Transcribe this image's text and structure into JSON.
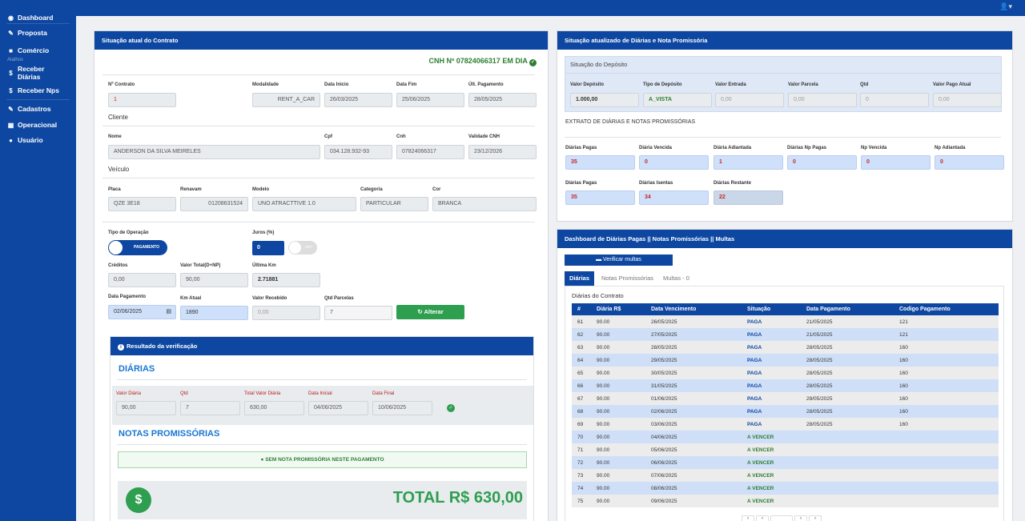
{
  "sidebar": {
    "items": [
      "Dashboard",
      "Proposta",
      "Comércio"
    ],
    "shortcut_label": "Atalhos",
    "shortcuts": [
      "Receber Diárias",
      "Receber Nps"
    ],
    "items2": [
      "Cadastros",
      "Operacional",
      "Usuário"
    ]
  },
  "left": {
    "title": "Situação atual do Contrato",
    "cnh_status": "CNH Nº 07824066317 EM DIA",
    "contract": {
      "labels": [
        "Nº Contrato",
        "Modalidade",
        "Data Inicio",
        "Data Fim",
        "Últ. Pagamento"
      ],
      "values": [
        "1",
        "RENT_A_CAR",
        "26/03/2025",
        "25/06/2025",
        "28/05/2025"
      ]
    },
    "client": {
      "section": "Cliente",
      "labels": [
        "Nome",
        "Cpf",
        "Cnh",
        "Validade CNH"
      ],
      "values": [
        "ANDERSON DA SILVA MEIRELES",
        "034.128.932-93",
        "07824066317",
        "23/12/2026"
      ]
    },
    "vehicle": {
      "section": "Veículo",
      "labels": [
        "Placa",
        "Renavam",
        "Modelo",
        "Categoria",
        "Cor"
      ],
      "values": [
        "QZE 3E18",
        "01208631524",
        "UNO ATRACTTIVE 1.0",
        "PARTICULAR",
        "BRANCA"
      ]
    },
    "operation": {
      "tipo_label": "Tipo de Operação",
      "tipo_value": "PAGAMENTO",
      "juros_label": "Juros (%)",
      "juros_value": "0",
      "juros_toggle": "OFF"
    },
    "row2": {
      "labels": [
        "Créditos",
        "Valor Total(D+NP)",
        "Última Km"
      ],
      "values": [
        "0,00",
        "90,00",
        "2.71881"
      ]
    },
    "row3": {
      "labels": [
        "Data Pagamento",
        "Km Atual",
        "Valor Recebido",
        "Qtd Parcelas"
      ],
      "values": [
        "02/06/2025",
        "1890",
        "0,00",
        "7"
      ],
      "button": "Alterar"
    },
    "result": {
      "title": "Resultado da verificação",
      "diarias_title": "DIÁRIAS",
      "labels": [
        "Valor Diária",
        "Qtd",
        "Total Valor Diária",
        "Data Inicial",
        "Data Final"
      ],
      "values": [
        "90,00",
        "7",
        "630,00",
        "04/06/2025",
        "10/06/2025"
      ],
      "np_title": "NOTAS PROMISSÓRIAS",
      "np_msg": "SEM NOTA PROMISSÓRIA NESTE PAGAMENTO",
      "total": "TOTAL R$ 630,00",
      "dollar": "$"
    }
  },
  "right": {
    "title": "Situação atualizado de Diárias e Nota Promissória",
    "deposit": {
      "section": "Situação do Depósito",
      "labels": [
        "Valor Depósito",
        "Tipo de Depósito",
        "Valor Entrada",
        "Valor Parcela",
        "Qtd",
        "Valor Pago Atual"
      ],
      "values": [
        "1.000,00",
        "A_VISTA",
        "0,00",
        "0,00",
        "0",
        "0,00"
      ]
    },
    "extrato": {
      "section": "EXTRATO DE DIÁRIAS E NOTAS PROMISSÓRIAS",
      "labels": [
        "Diárias Pagas",
        "Diária Vencida",
        "Diária Adiantada",
        "Diárias Np Pagas",
        "Np Vencida",
        "Np Adiantada"
      ],
      "values": [
        "35",
        "0",
        "1",
        "0",
        "0",
        "0"
      ],
      "labels2": [
        "Diárias Pagas",
        "Diárias Isentas",
        "Diárias Restante"
      ],
      "values2": [
        "35",
        "34",
        "22"
      ]
    }
  },
  "dash": {
    "title": "Dashboard de Diárias Pagas || Notas Promissórias || Multas",
    "verify_btn": "Verificar multas",
    "tabs": [
      "Diárias",
      "Notas Promissórias",
      "Multas - 0"
    ],
    "table_title": "Diárias do Contrato",
    "columns": [
      "#",
      "Diária R$",
      "Data Vencimento",
      "Situação",
      "Data Pagamento",
      "Codigo Pagamento"
    ],
    "rows": [
      [
        "61",
        "90.00",
        "26/05/2025",
        "PAGA",
        "21/05/2025",
        "121"
      ],
      [
        "62",
        "90.00",
        "27/05/2025",
        "PAGA",
        "21/05/2025",
        "121"
      ],
      [
        "63",
        "90.00",
        "28/05/2025",
        "PAGA",
        "28/05/2025",
        "160"
      ],
      [
        "64",
        "90.00",
        "29/05/2025",
        "PAGA",
        "28/05/2025",
        "160"
      ],
      [
        "65",
        "90.00",
        "30/05/2025",
        "PAGA",
        "28/05/2025",
        "160"
      ],
      [
        "66",
        "90.00",
        "31/05/2025",
        "PAGA",
        "28/05/2025",
        "160"
      ],
      [
        "67",
        "90.00",
        "01/06/2025",
        "PAGA",
        "28/05/2025",
        "160"
      ],
      [
        "68",
        "90.00",
        "02/06/2025",
        "PAGA",
        "28/05/2025",
        "160"
      ],
      [
        "69",
        "90.00",
        "03/06/2025",
        "PAGA",
        "28/05/2025",
        "160"
      ],
      [
        "70",
        "90.00",
        "04/06/2025",
        "A VENCER",
        "",
        ""
      ],
      [
        "71",
        "90.00",
        "05/06/2025",
        "A VENCER",
        "",
        ""
      ],
      [
        "72",
        "90.00",
        "06/06/2025",
        "A VENCER",
        "",
        ""
      ],
      [
        "73",
        "90.00",
        "07/06/2025",
        "A VENCER",
        "",
        ""
      ],
      [
        "74",
        "90.00",
        "08/06/2025",
        "A VENCER",
        "",
        ""
      ],
      [
        "75",
        "90.00",
        "09/06/2025",
        "A VENCER",
        "",
        ""
      ]
    ]
  },
  "colors": {
    "primary": "#0d47a1",
    "green": "#2e7d32",
    "light_blue": "#cfe0fb"
  }
}
